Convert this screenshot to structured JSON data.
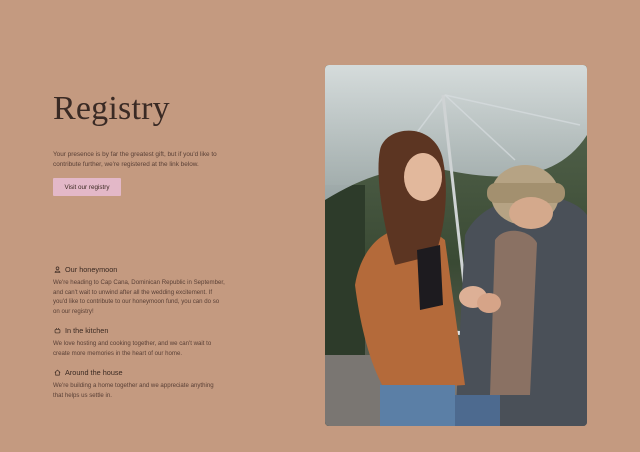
{
  "registry": {
    "title": "Registry",
    "intro": "Your presence is by far the greatest gift, but if you'd like to contribute further, we're registered at the link below.",
    "button_label": "Visit our registry"
  },
  "sections": [
    {
      "icon": "honeymoon-icon",
      "title": "Our honeymoon",
      "body": "We're heading to Cap Cana, Dominican Republic in September, and can't wait to unwind after all the wedding excitement. If you'd like to contribute to our honeymoon fund, you can do so on our registry!"
    },
    {
      "icon": "cooking-pot-icon",
      "title": "In the kitchen",
      "body": "We love hosting and cooking together, and we can't wait to create more memories in the heart of our home."
    },
    {
      "icon": "home-icon",
      "title": "Around the house",
      "body": "We're building a home together and we appreciate anything that helps us settle in."
    }
  ],
  "photo": {
    "subject": "couple-under-umbrella-photo"
  },
  "colors": {
    "background": "#c49a80",
    "button": "#e3b8c8",
    "text": "#3b2a22"
  }
}
